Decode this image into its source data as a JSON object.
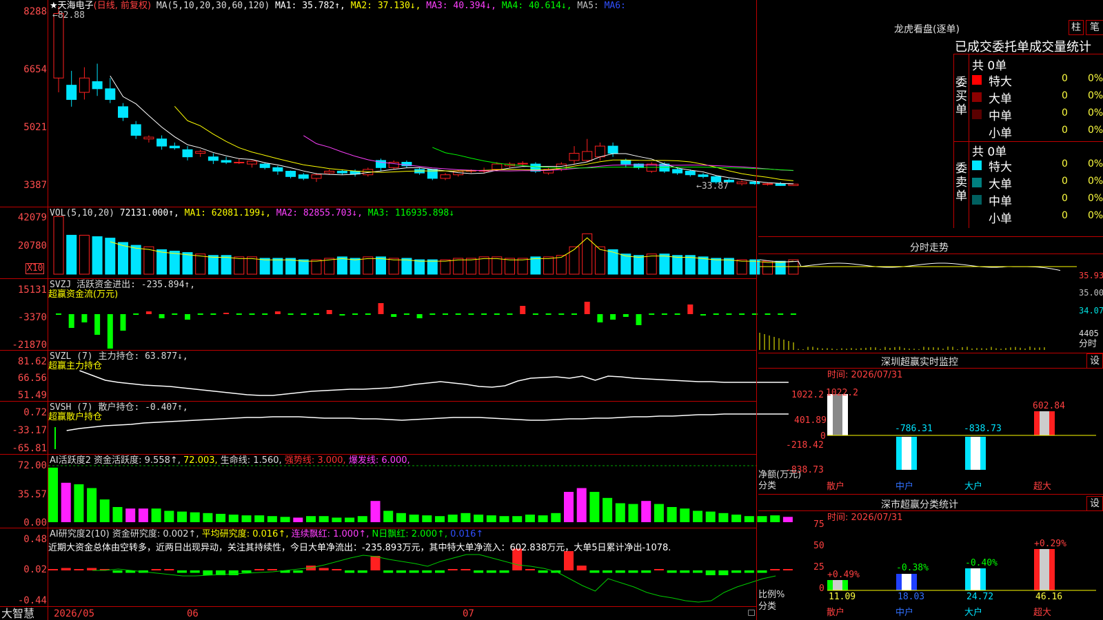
{
  "colors": {
    "up": "#ff2020",
    "down": "#00e5ff",
    "frame": "#c00000",
    "ma1": "#ffffff",
    "ma2": "#ffff00",
    "ma3": "#ff40ff",
    "ma4": "#00ff00",
    "ma5": "#0000ff",
    "green": "#00ff00"
  },
  "brand": "大智慧",
  "stock": {
    "name": "★天海电子",
    "period": "(日线, 前复权)",
    "ma_label": "MA(5,10,20,30,60,120)",
    "ma": [
      "MA1: 35.782↑,",
      "MA2: 37.130↓,",
      "MA3: 40.394↓,",
      "MA4: 40.614↓,",
      "MA5:",
      "MA6:"
    ],
    "y_ticks": [
      "8288",
      "6654",
      "5021",
      "3387"
    ],
    "high_note": "←82.88",
    "low_note": "←33.87"
  },
  "vol": {
    "label": "VOL(5,10,20)",
    "value": "72131.000↑,",
    "ma": [
      "MA1: 62081.199↓,",
      "MA2: 82855.703↓,",
      "MA3: 116935.898↓"
    ],
    "y_ticks": [
      "42079",
      "20780"
    ],
    "unit": "X10"
  },
  "svzj": {
    "label": "SVZJ  活跃资金进出: -235.894↑,",
    "sub": "超赢资金流(万元)",
    "y_ticks": [
      "15131",
      "-3370",
      "-21870"
    ]
  },
  "svzl": {
    "label": "SVZL (7) 主力持仓: 63.877↓,",
    "sub": "超赢主力持仓",
    "y_ticks": [
      "81.62",
      "66.56",
      "51.49"
    ]
  },
  "svsh": {
    "label": "SVSH (7) 散户持仓: -0.407↑,",
    "sub": "超赢散户持仓",
    "y_ticks": [
      "0.72",
      "-33.17",
      "-65.81"
    ]
  },
  "ai_active": {
    "label": "AI活跃度2 资金活跃度: 9.558↑,",
    "v2": "72.003,",
    "v3": "生命线: 1.560,",
    "v4": "强势线: 3.000,",
    "v5": "爆发线: 6.000,",
    "y_ticks": [
      "72.00",
      "35.57",
      "0.00"
    ]
  },
  "ai_research": {
    "label": "AI研究度2(10) 资金研究度: 0.002↑,",
    "v2": "平均研究度: 0.016↑,",
    "v3": "连续飘红: 1.000↑,",
    "v4": "N日飘红: 2.000↑,",
    "v5": "0.016↑",
    "commentary": "近期大资金总体由空转多，近两日出现异动，关注其持续性，今日大单净流出：-235.893万元，其中特大单净流入：602.838万元，大单5日累计净出-1078.",
    "y_ticks": [
      "0.48",
      "0.02",
      "-0.44"
    ]
  },
  "x_axis": [
    "2026/05",
    "06",
    "07"
  ],
  "right": {
    "lhkp_title": "龙虎看盘(逐单)",
    "btn_bar": "柱",
    "btn_each": "笔",
    "stat_title": "已成交委托单成交量统计",
    "buy_group": "委买单",
    "sell_group": "委卖单",
    "buy_total": "共 0单",
    "sell_total": "共 0单",
    "buy_rows": [
      {
        "name": "特大",
        "v": "0",
        "p": "0%"
      },
      {
        "name": "大单",
        "v": "0",
        "p": "0%"
      },
      {
        "name": "中单",
        "v": "0",
        "p": "0%"
      },
      {
        "name": "小单",
        "v": "0",
        "p": "0%"
      }
    ],
    "sell_rows": [
      {
        "name": "特大",
        "v": "0",
        "p": "0%"
      },
      {
        "name": "大单",
        "v": "0",
        "p": "0%"
      },
      {
        "name": "中单",
        "v": "0",
        "p": "0%"
      },
      {
        "name": "小单",
        "v": "0",
        "p": "0%"
      }
    ],
    "intraday_title": "分时走势",
    "intraday_ticks": [
      "35.93",
      "35.00",
      "34.07",
      "4405",
      "分时"
    ],
    "sz_title": "深圳超赢实时监控",
    "set_btn": "设",
    "sz_time": "时间: 2026/07/31",
    "sz_y": [
      "1022.2",
      "401.89",
      "0",
      "-218.42",
      "-838.73"
    ],
    "sz_ylabel": "净额(万元)",
    "sz_cat_label": "分类",
    "sz_bars": [
      {
        "cat": "散户",
        "value": "1022.2"
      },
      {
        "cat": "中户",
        "value": "-786.31"
      },
      {
        "cat": "大户",
        "value": "-838.73"
      },
      {
        "cat": "超大",
        "value": "602.84"
      }
    ],
    "cls_title": "深市超赢分类统计",
    "cls_time": "时间: 2026/07/31",
    "cls_y": [
      "75",
      "50",
      "25",
      "0"
    ],
    "cls_ylabel": "比例%",
    "cls_cat_label": "分类",
    "cls_bars": [
      {
        "cat": "散户",
        "pct": "11.09",
        "chg": "+0.49%"
      },
      {
        "cat": "中户",
        "pct": "18.03",
        "chg": "-0.38%"
      },
      {
        "cat": "大户",
        "pct": "24.72",
        "chg": "-0.40%"
      },
      {
        "cat": "超大",
        "pct": "46.16",
        "chg": "+0.29%"
      }
    ]
  }
}
